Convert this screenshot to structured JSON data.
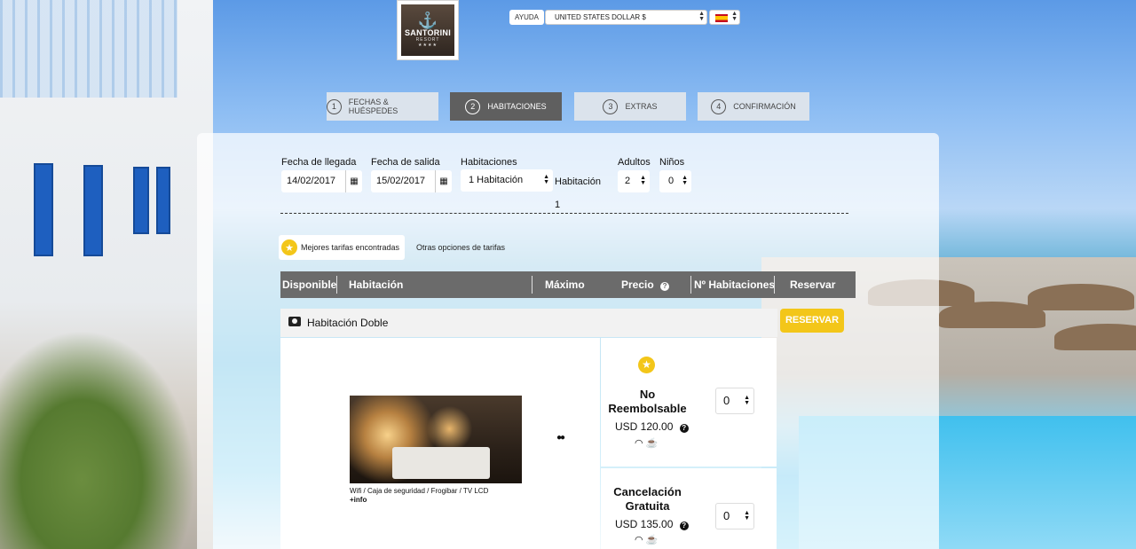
{
  "header": {
    "logo_name": "SANTORINI",
    "logo_sub": "RESORT",
    "logo_stars": "★★★★",
    "help_label": "AYUDA",
    "currency_value": "UNITED STATES DOLLAR $"
  },
  "steps": [
    {
      "num": "1",
      "label": "FECHAS & HUÉSPEDES"
    },
    {
      "num": "2",
      "label": "HABITACIONES"
    },
    {
      "num": "3",
      "label": "EXTRAS"
    },
    {
      "num": "4",
      "label": "CONFIRMACIÓN"
    }
  ],
  "search": {
    "arrival_label": "Fecha de llegada",
    "arrival_value": "14/02/2017",
    "departure_label": "Fecha de salida",
    "departure_value": "15/02/2017",
    "rooms_label": "Habitaciones",
    "rooms_value": "1 Habitación",
    "room_row_label": "Habitación",
    "room_row_number": "1",
    "adults_label": "Adultos",
    "adults_value": "2",
    "children_label": "Niños",
    "children_value": "0"
  },
  "rate_tabs": {
    "best": "Mejores tarifas encontradas",
    "other": "Otras opciones de tarifas"
  },
  "table_headers": {
    "available": "Disponible",
    "room": "Habitación",
    "max": "Máximo",
    "price": "Precio",
    "num_rooms": "Nº Habitaciones",
    "book": "Reservar"
  },
  "room": {
    "name": "Habitación Doble",
    "reserve_label": "RESERVAR",
    "amenities": "Wifi / Caja de seguridad / Frogibar / TV LCD",
    "more_info": "+info",
    "rates": [
      {
        "title": "No Reembolsable",
        "price": "USD 120.00",
        "qty": "0"
      },
      {
        "title": "Cancelación Gratuita",
        "price": "USD 135.00",
        "qty": "0"
      }
    ]
  },
  "colors": {
    "accent": "#f3c619",
    "header_bar": "#6b6b6b",
    "active_step": "#5f5f5f"
  }
}
